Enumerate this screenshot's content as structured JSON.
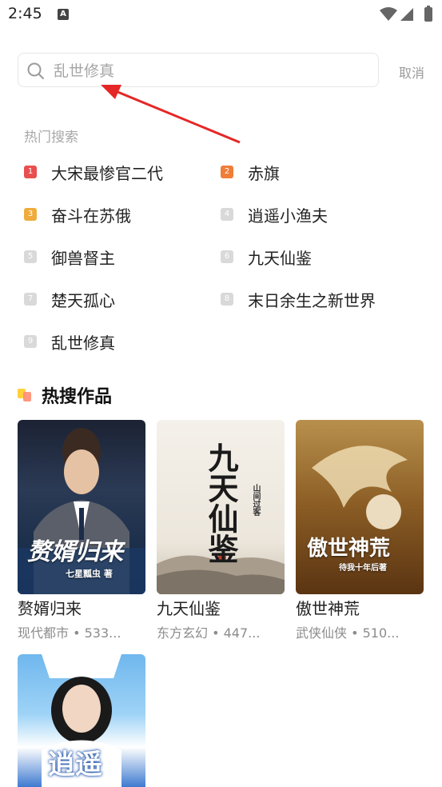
{
  "status_bar": {
    "time": "2:45",
    "notif_letter": "A"
  },
  "search": {
    "placeholder": "乱世修真",
    "cancel_label": "取消"
  },
  "hot_search": {
    "title": "热门搜索",
    "items": [
      {
        "rank": "1",
        "label": "大宋最惨官二代",
        "color": "#e94f4f"
      },
      {
        "rank": "2",
        "label": "赤旗",
        "color": "#f07d38"
      },
      {
        "rank": "3",
        "label": "奋斗在苏俄",
        "color": "#efac3c"
      },
      {
        "rank": "4",
        "label": "逍遥小渔夫",
        "color": "#d9d9d9"
      },
      {
        "rank": "5",
        "label": "御兽督主",
        "color": "#d9d9d9"
      },
      {
        "rank": "6",
        "label": "九天仙鉴",
        "color": "#d9d9d9"
      },
      {
        "rank": "7",
        "label": "楚天孤心",
        "color": "#d9d9d9"
      },
      {
        "rank": "8",
        "label": "末日余生之新世界",
        "color": "#d9d9d9"
      },
      {
        "rank": "9",
        "label": "乱世修真",
        "color": "#d9d9d9"
      }
    ]
  },
  "hot_works": {
    "title": "热搜作品",
    "books": [
      {
        "title": "赘婿归来",
        "meta": "现代都市 • 533...",
        "cover_title": "赘婿归来",
        "cover_author": "七星瓢虫 著"
      },
      {
        "title": "九天仙鉴",
        "meta": "东方玄幻 • 447...",
        "cover_title": "九天仙鉴",
        "cover_author": "山间过客"
      },
      {
        "title": "傲世神荒",
        "meta": "武侠仙侠 • 510...",
        "cover_title": "傲世神荒",
        "cover_author": "待我十年后著"
      },
      {
        "title": "",
        "meta": "",
        "cover_title": "逍遥",
        "cover_author": ""
      }
    ]
  }
}
